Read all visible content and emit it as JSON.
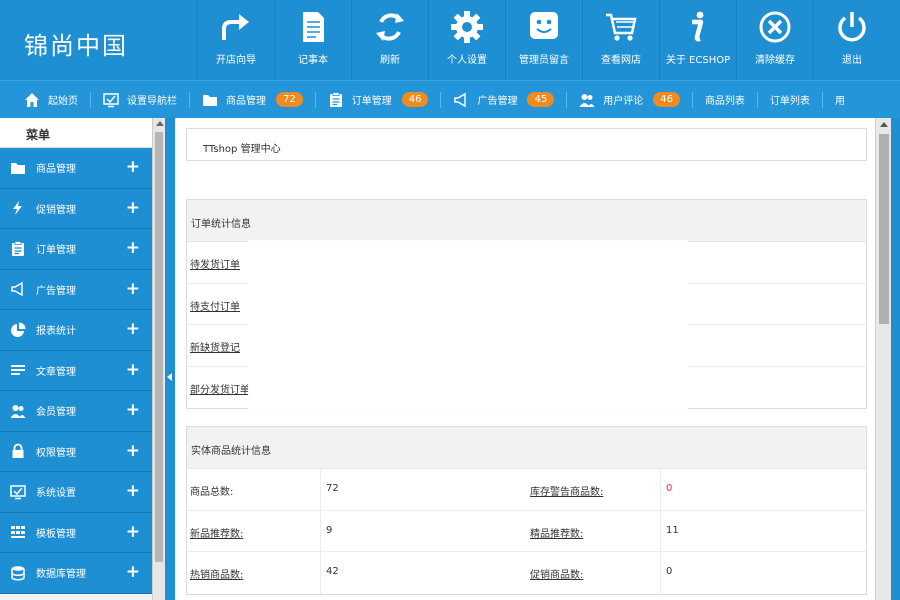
{
  "header": {
    "logo": "锦尚中国",
    "tools": [
      {
        "label": "开店向导",
        "icon": "arrow-turn-icon"
      },
      {
        "label": "记事本",
        "icon": "notepad-icon"
      },
      {
        "label": "刷新",
        "icon": "refresh-icon"
      },
      {
        "label": "个人设置",
        "icon": "gear-icon"
      },
      {
        "label": "管理员留言",
        "icon": "smiley-message-icon"
      },
      {
        "label": "查看网店",
        "icon": "shopping-cart-icon"
      },
      {
        "label": "关于 ECSHOP",
        "icon": "info-icon"
      },
      {
        "label": "清除缓存",
        "icon": "close-circle-icon"
      },
      {
        "label": "退出",
        "icon": "power-icon"
      }
    ]
  },
  "nav": {
    "items": [
      {
        "label": "起始页",
        "icon": "home-icon"
      },
      {
        "label": "设置导航栏",
        "icon": "monitor-check-icon"
      },
      {
        "label": "商品管理",
        "icon": "folder-icon",
        "badge": "72"
      },
      {
        "label": "订单管理",
        "icon": "clipboard-icon",
        "badge": "46"
      },
      {
        "label": "广告管理",
        "icon": "megaphone-icon",
        "badge": "45"
      },
      {
        "label": "用户评论",
        "icon": "users-icon",
        "badge": "46"
      },
      {
        "label": "商品列表"
      },
      {
        "label": "订单列表"
      },
      {
        "label": "用"
      }
    ]
  },
  "sidebar": {
    "title": "菜单",
    "items": [
      {
        "label": "商品管理",
        "icon": "folder-icon"
      },
      {
        "label": "促销管理",
        "icon": "lightning-icon"
      },
      {
        "label": "订单管理",
        "icon": "clipboard-icon"
      },
      {
        "label": "广告管理",
        "icon": "megaphone-icon"
      },
      {
        "label": "报表统计",
        "icon": "pie-chart-icon"
      },
      {
        "label": "文章管理",
        "icon": "list-icon"
      },
      {
        "label": "会员管理",
        "icon": "users-icon"
      },
      {
        "label": "权限管理",
        "icon": "lock-icon"
      },
      {
        "label": "系统设置",
        "icon": "monitor-check-icon"
      },
      {
        "label": "模板管理",
        "icon": "grid-icon"
      },
      {
        "label": "数据库管理",
        "icon": "database-icon"
      }
    ],
    "expand_symbol": "+"
  },
  "main": {
    "page_title": "TTshop 管理中心",
    "order_panel": {
      "title": "订单统计信息",
      "rows": [
        {
          "label": "待发货订单"
        },
        {
          "label": "待支付订单"
        },
        {
          "label": "新缺货登记"
        },
        {
          "label": "部分发货订单"
        }
      ]
    },
    "goods_panel": {
      "title": "实体商品统计信息",
      "rows": [
        {
          "label1": "商品总数:",
          "value1": "72",
          "label2": "库存警告商品数:",
          "value2": "0"
        },
        {
          "label1": "新品推荐数:",
          "value1": "9",
          "label2": "精品推荐数:",
          "value2": "11"
        },
        {
          "label1": "热销商品数:",
          "value1": "42",
          "label2": "促销商品数:",
          "value2": "0"
        }
      ]
    }
  },
  "colors": {
    "primary": "#1f8fd4",
    "badge": "#f08c1e",
    "warning_value": "#e33333"
  }
}
